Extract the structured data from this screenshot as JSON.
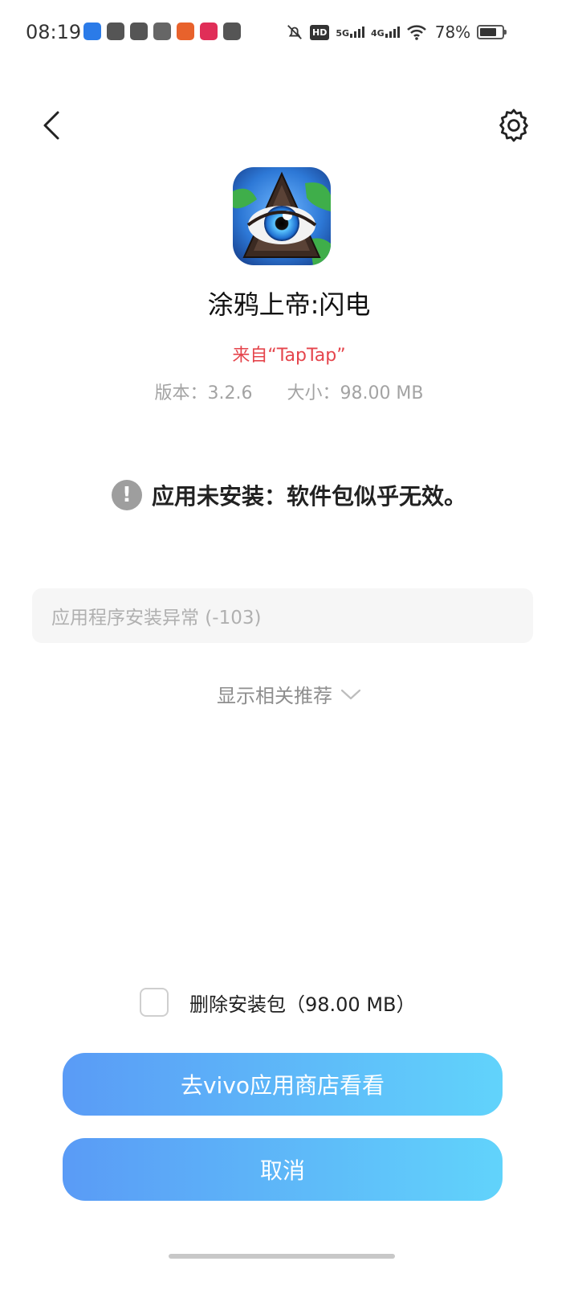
{
  "status_bar": {
    "time": "08:19",
    "network_1": "5G",
    "network_2": "4G",
    "battery": "78%",
    "battery_level": 0.78,
    "hd_label": "HD"
  },
  "nav": {
    "back_icon": "chevron-left-icon",
    "settings_icon": "gear-icon"
  },
  "app": {
    "name": "涂鸦上帝:闪电",
    "source": "来自“TapTap”",
    "version": "版本：3.2.6",
    "size": "大小：98.00 MB"
  },
  "error": {
    "icon": "!",
    "message": "应用未安装：软件包似乎无效。",
    "code": "应用程序安装异常 (-103)"
  },
  "recommend": {
    "label": "显示相关推荐"
  },
  "delete_package": {
    "label": "删除安装包（98.00 MB）",
    "checked": false
  },
  "buttons": {
    "store": "去vivo应用商店看看",
    "cancel": "取消"
  },
  "colors": {
    "source_red": "#e5454c",
    "button_gradient_start": "#5a9bf6",
    "button_gradient_end": "#61d3fb"
  }
}
